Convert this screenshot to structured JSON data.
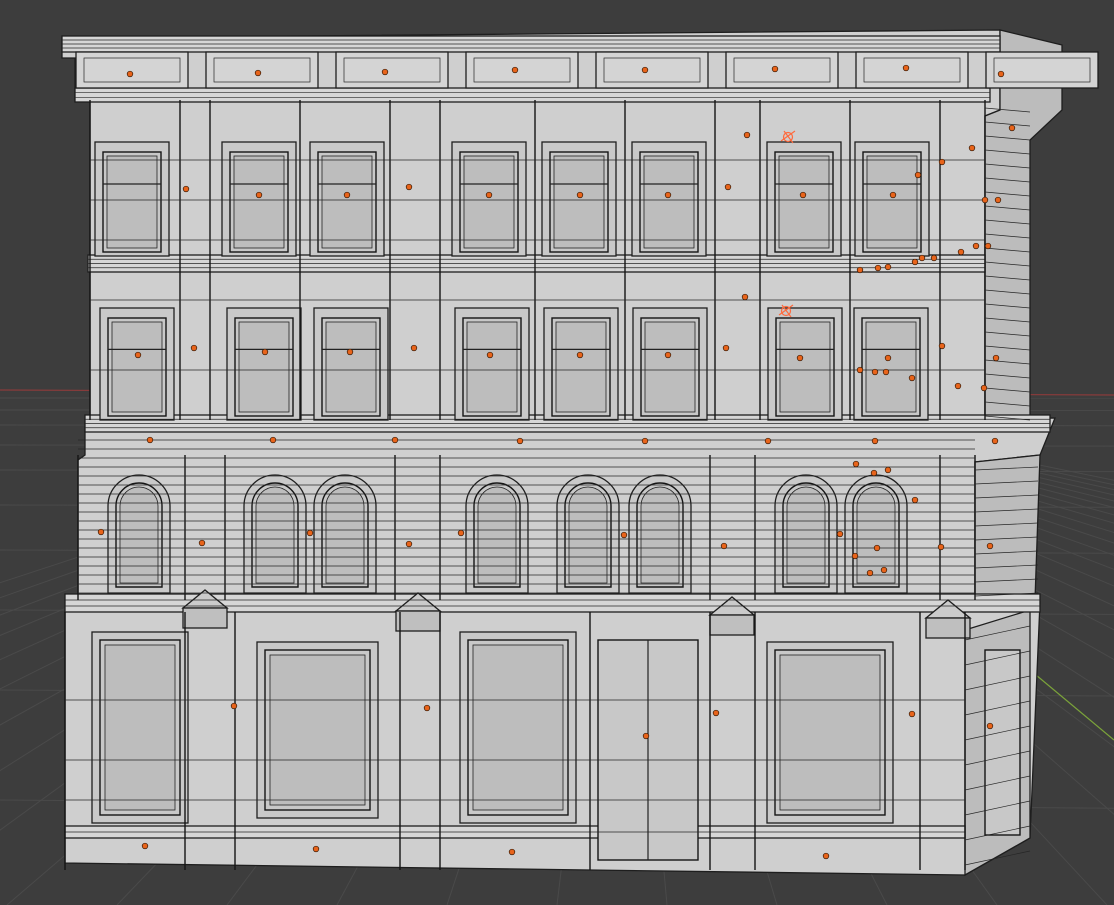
{
  "viewport": {
    "mode": "edit-wireframe-overlay",
    "background_color": "#3d3d3d",
    "grid_color": "#4a4a4a",
    "x_axis_color": "#8a3b3b",
    "y_axis_color": "#7ba33a",
    "origin_marker_color": "#e8641b",
    "selected_empty_color": "#ff6a3d"
  },
  "model": {
    "type": "building-facade",
    "floors": 4,
    "surface_color": "#cfcfcf",
    "side_face_color": "#bcbcbc",
    "edge_color": "#1e1e1e",
    "icons": [
      "empty-object-icon",
      "origin-point-icon"
    ]
  }
}
